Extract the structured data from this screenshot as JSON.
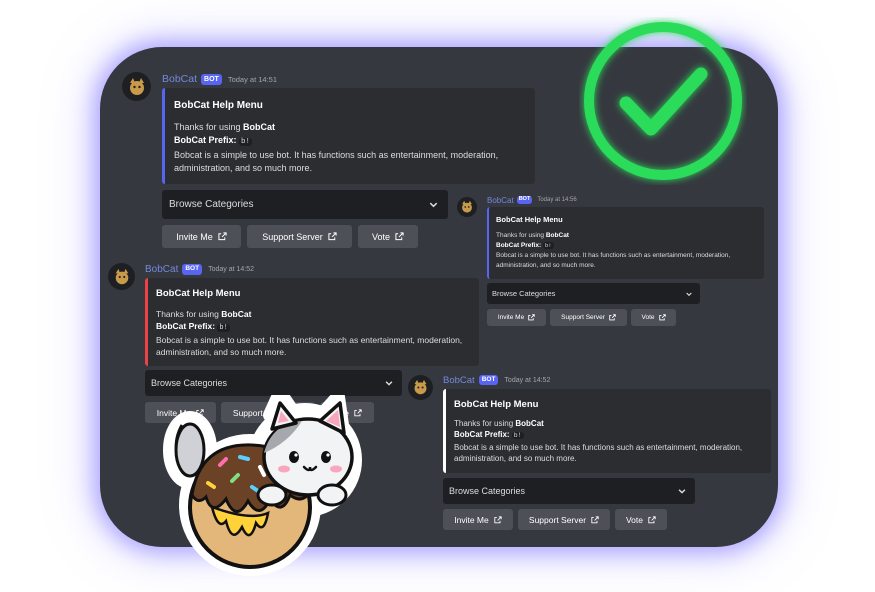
{
  "bot": {
    "name": "BobCat",
    "tag": "BOT"
  },
  "messages": [
    {
      "timestamp": "Today at 14:51"
    },
    {
      "timestamp": "Today at 14:56"
    },
    {
      "timestamp": "Today at 14:52"
    },
    {
      "timestamp": "Today at 14:52"
    }
  ],
  "embed": {
    "title": "BobCat Help Menu",
    "thanks_prefix": "Thanks for using ",
    "thanks_name": "BobCat",
    "prefix_label": "BobCat Prefix:",
    "prefix_value": "b!",
    "description": "Bobcat is a simple to use bot. It has functions such as entertainment, moderation, administration, and so much more."
  },
  "select": {
    "placeholder": "Browse Categories"
  },
  "buttons": {
    "invite": "Invite Me",
    "support": "Support Server",
    "vote": "Vote"
  },
  "colors": {
    "background": "#36383f",
    "embed_bar_1": "#5865f2",
    "embed_bar_2": "#5865f2",
    "embed_bar_3": "#ed4245",
    "embed_bar_4": "#ffffff",
    "check": "#2bdc5a",
    "username": "#7289da"
  },
  "icons": {
    "select": "chevron-down-icon",
    "buttons": "external-link-icon",
    "badge": "check-icon",
    "sticker": "cat-donut-icon"
  }
}
